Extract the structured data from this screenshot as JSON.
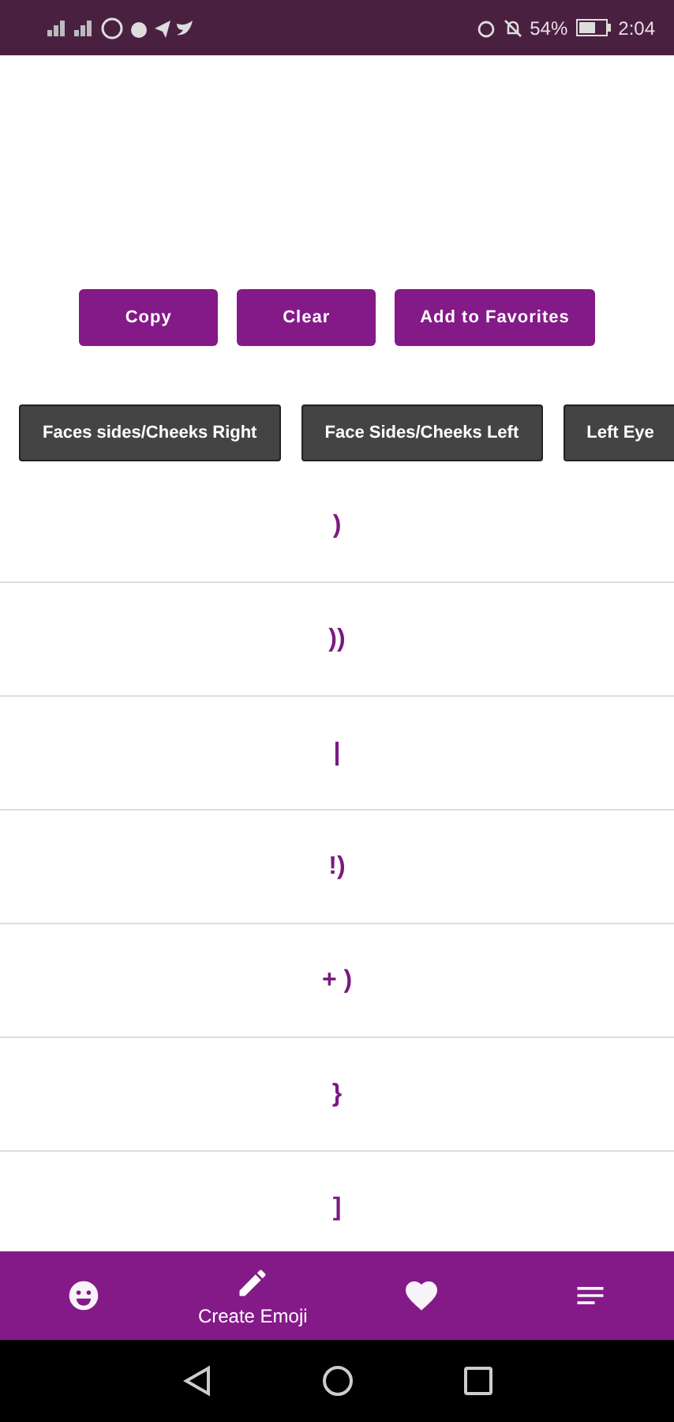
{
  "status_bar": {
    "battery": "54%",
    "time": "2:04"
  },
  "actions": [
    "Copy",
    "Clear",
    "Add to Favorites"
  ],
  "categories": [
    {
      "label": "Faces sides/Cheeks Right",
      "selected": false
    },
    {
      "label": "Face Sides/Cheeks Left",
      "selected": false
    },
    {
      "label": "Left Eye",
      "selected": false
    }
  ],
  "symbols": [
    ")",
    "))",
    "|",
    "!)",
    "+ )",
    "}",
    "]"
  ],
  "bottom_nav": [
    {
      "kind": "smile",
      "selected": false
    },
    {
      "kind": "pencil",
      "label": "Create Emoji",
      "selected": true
    },
    {
      "kind": "heart",
      "selected": false
    },
    {
      "kind": "list",
      "selected": false
    }
  ]
}
